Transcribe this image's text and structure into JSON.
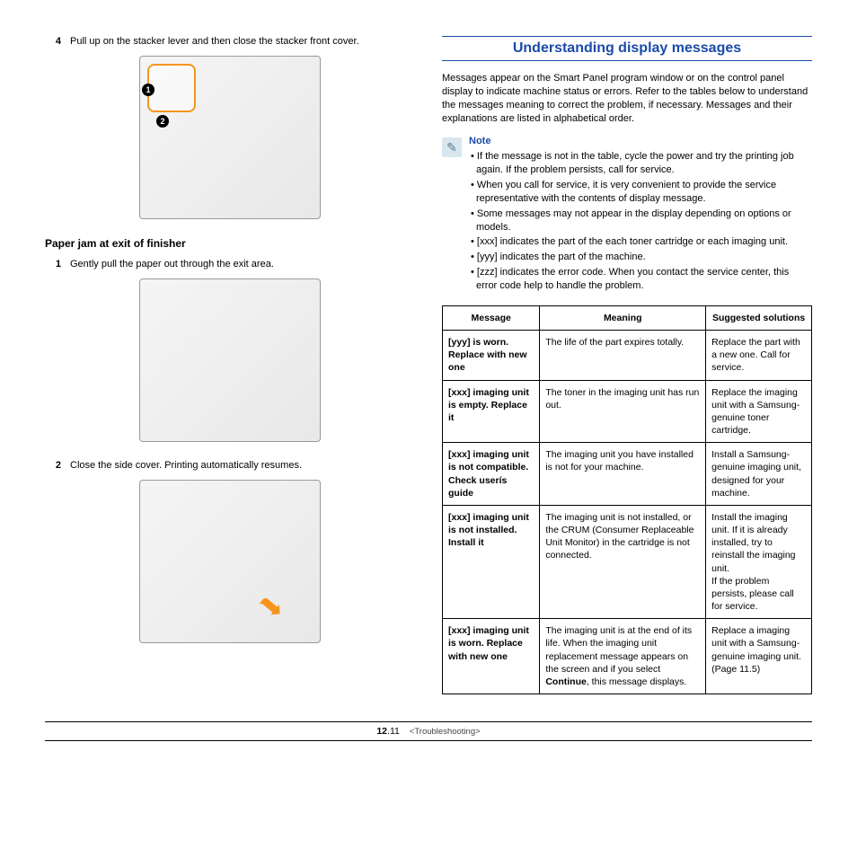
{
  "left": {
    "step4": {
      "num": "4",
      "text": "Pull up on the stacker lever and then close the stacker front cover."
    },
    "subheading": "Paper jam at exit of finisher",
    "step1": {
      "num": "1",
      "text": "Gently pull the paper out through the exit area."
    },
    "step2": {
      "num": "2",
      "text": "Close the side cover. Printing automatically resumes."
    }
  },
  "right": {
    "title": "Understanding display messages",
    "intro": "Messages appear on the Smart Panel program window or on the control panel display to indicate machine status or errors. Refer to the tables below to understand the messages meaning to correct the problem, if necessary. Messages and their explanations are listed in alphabetical order.",
    "note_label": "Note",
    "notes": [
      "If the message is not in the table, cycle the power and try the printing job again. If the problem persists, call for service.",
      "When you call for service, it is very convenient to provide the service representative with the contents of display message.",
      "Some messages may not appear in the display depending on options or models.",
      "[xxx] indicates the part of the each toner cartridge or each imaging unit.",
      "[yyy] indicates the part of the machine.",
      "[zzz] indicates the error code. When you contact the service center, this error code help to handle the problem."
    ],
    "table": {
      "headers": [
        "Message",
        "Meaning",
        "Suggested solutions"
      ],
      "rows": [
        {
          "message": "[yyy] is worn. Replace with new one",
          "meaning": "The life of the part expires totally.",
          "solution": "Replace the part with a new one. Call for service."
        },
        {
          "message": "[xxx] imaging unit is empty. Replace it",
          "meaning": "The toner in the imaging unit has run out.",
          "solution": "Replace the imaging unit with a Samsung-genuine toner cartridge."
        },
        {
          "message": "[xxx] imaging unit is not compatible. Check userís guide",
          "meaning": "The imaging unit you have installed is not for your machine.",
          "solution": "Install a Samsung-genuine imaging unit, designed for your machine."
        },
        {
          "message": "[xxx] imaging unit is not installed. Install it",
          "meaning": "The imaging unit is not installed, or the CRUM (Consumer Replaceable Unit Monitor) in the cartridge is not connected.",
          "solution": "Install the imaging unit. If it is already installed, try to reinstall the imaging unit.\nIf the problem persists, please call for service."
        },
        {
          "message": "[xxx] imaging unit is worn. Replace with new one",
          "meaning_pre": "The imaging unit is at the end of its life. When the imaging unit replacement message appears on the screen and if you select ",
          "meaning_bold": "Continue",
          "meaning_post": ", this message displays.",
          "solution": "Replace a imaging unit with a Samsung-genuine imaging unit. (Page 11.5)"
        }
      ]
    }
  },
  "footer": {
    "page_bold": "12",
    "page_rest": ".11",
    "section": "<Troubleshooting>"
  }
}
